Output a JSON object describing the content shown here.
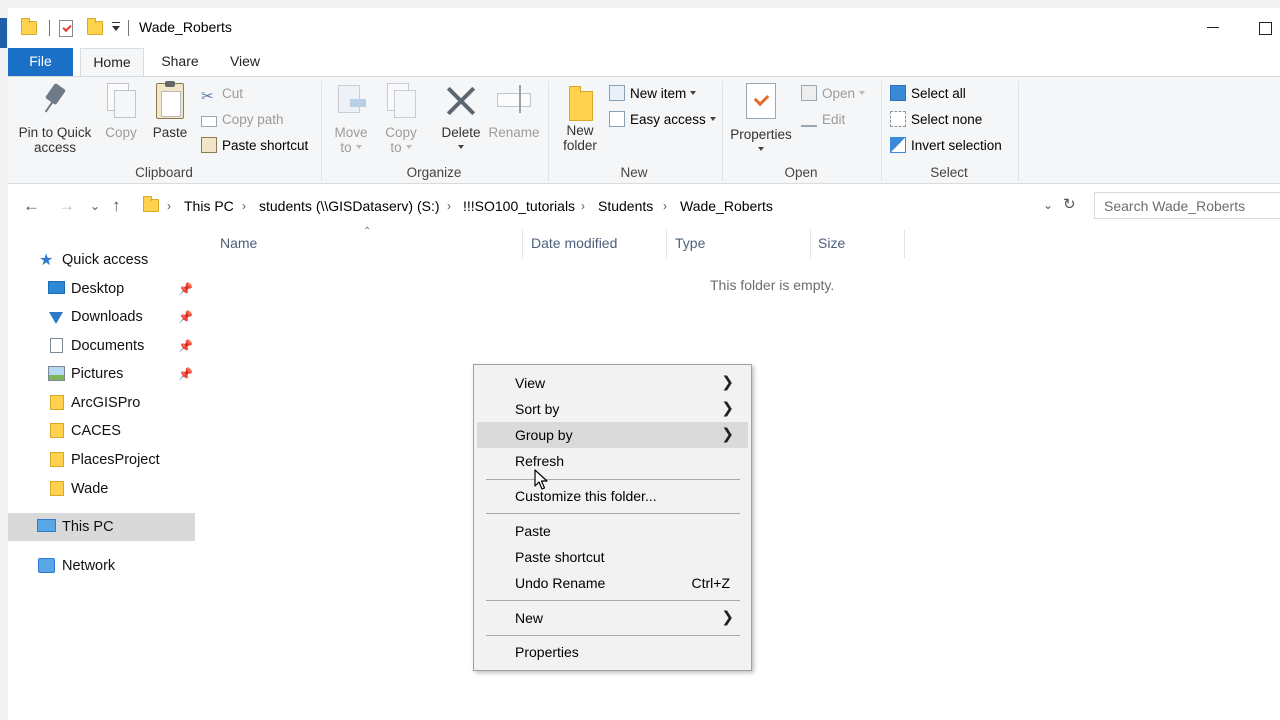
{
  "window": {
    "title": "Wade_Roberts"
  },
  "ribbon": {
    "tabs": {
      "file": "File",
      "home": "Home",
      "share": "Share",
      "view": "View"
    },
    "clipboard": {
      "group_label": "Clipboard",
      "pin": [
        "Pin to Quick",
        "access"
      ],
      "copy": "Copy",
      "paste": "Paste",
      "cut": "Cut",
      "copy_path": "Copy path",
      "paste_shortcut": "Paste shortcut"
    },
    "organize": {
      "group_label": "Organize",
      "move_to": [
        "Move",
        "to"
      ],
      "copy_to": [
        "Copy",
        "to"
      ],
      "delete": "Delete",
      "rename": "Rename"
    },
    "new": {
      "group_label": "New",
      "new_folder": [
        "New",
        "folder"
      ],
      "new_item": "New item",
      "easy_access": "Easy access"
    },
    "open": {
      "group_label": "Open",
      "properties": "Properties",
      "open": "Open",
      "edit": "Edit"
    },
    "select": {
      "group_label": "Select",
      "select_all": "Select all",
      "select_none": "Select none",
      "invert_selection": "Invert selection"
    }
  },
  "address": {
    "crumbs": [
      "This PC",
      "students (\\\\GISDataserv) (S:)",
      "!!!SO100_tutorials",
      "Students",
      "Wade_Roberts"
    ],
    "search_placeholder": "Search Wade_Roberts"
  },
  "navpane": {
    "quick_access": "Quick access",
    "items": [
      "Desktop",
      "Downloads",
      "Documents",
      "Pictures",
      "ArcGISPro",
      "CACES",
      "PlacesProject",
      "Wade"
    ],
    "this_pc": "This PC",
    "network": "Network"
  },
  "filelist": {
    "columns": [
      "Name",
      "Date modified",
      "Type",
      "Size"
    ],
    "empty_message": "This folder is empty."
  },
  "context_menu": {
    "items": {
      "view": "View",
      "sort_by": "Sort by",
      "group_by": "Group by",
      "refresh": "Refresh",
      "customize": "Customize this folder...",
      "paste": "Paste",
      "paste_shortcut": "Paste shortcut",
      "undo_rename": "Undo Rename",
      "undo_shortcut": "Ctrl+Z",
      "new": "New",
      "properties": "Properties"
    },
    "highlighted": "Group by"
  },
  "colors": {
    "accent": "#1a6fc7",
    "ribbon_bg": "#f5f6f7",
    "menu_bg": "#f2f2f2",
    "selected_nav": "#d9d9d9"
  }
}
